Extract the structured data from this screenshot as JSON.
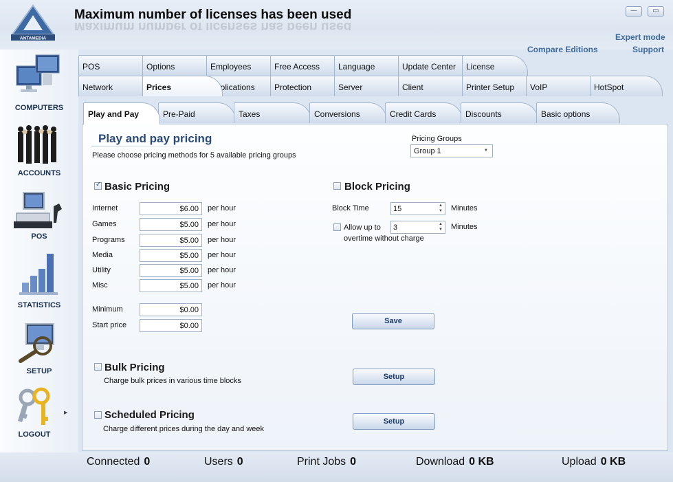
{
  "header": {
    "title": "Maximum number of licenses has been used",
    "logo_text": "ANTAMEDIA",
    "minimize_label": "—",
    "maximize_label": "▭",
    "expert_mode": "Expert mode",
    "compare_editions": "Compare Editions",
    "support": "Support"
  },
  "sidebar": {
    "items": [
      {
        "label": "COMPUTERS",
        "icon": "computers-icon"
      },
      {
        "label": "ACCOUNTS",
        "icon": "accounts-icon"
      },
      {
        "label": "POS",
        "icon": "pos-icon"
      },
      {
        "label": "STATISTICS",
        "icon": "statistics-icon"
      },
      {
        "label": "SETUP",
        "icon": "setup-icon"
      },
      {
        "label": "LOGOUT",
        "icon": "logout-icon"
      }
    ],
    "arrow": "▶"
  },
  "tabs_row1": [
    "POS",
    "Options",
    "Employees",
    "Free Access",
    "Language",
    "Update Center",
    "License"
  ],
  "tabs_row2": [
    "Network",
    "Prices",
    "Applications",
    "Protection",
    "Server",
    "Client",
    "Printer Setup",
    "VoIP",
    "HotSpot"
  ],
  "active_tab": "Prices",
  "subtabs": [
    "Play and Pay",
    "Pre-Paid",
    "Taxes",
    "Conversions",
    "Credit Cards",
    "Discounts",
    "Basic options"
  ],
  "active_subtab": "Play and Pay",
  "content": {
    "title": "Play and pay pricing",
    "subtitle": "Please choose pricing methods for 5 available pricing groups",
    "pricing_groups_label": "Pricing Groups",
    "pricing_group_value": "Group 1",
    "basic_pricing": {
      "label": "Basic Pricing",
      "checked": true,
      "rows": [
        {
          "label": "Internet",
          "value": "$6.00",
          "unit": "per hour"
        },
        {
          "label": "Games",
          "value": "$5.00",
          "unit": "per hour"
        },
        {
          "label": "Programs",
          "value": "$5.00",
          "unit": "per hour"
        },
        {
          "label": "Media",
          "value": "$5.00",
          "unit": "per hour"
        },
        {
          "label": "Utility",
          "value": "$5.00",
          "unit": "per hour"
        },
        {
          "label": "Misc",
          "value": "$5.00",
          "unit": "per hour"
        }
      ],
      "minimum_label": "Minimum",
      "minimum_value": "$0.00",
      "start_price_label": "Start price",
      "start_price_value": "$0.00"
    },
    "block_pricing": {
      "label": "Block Pricing",
      "checked": false,
      "block_time_label": "Block Time",
      "block_time_value": "15",
      "minutes_label": "Minutes",
      "allow_label": "Allow up to",
      "allow_value": "3",
      "allow_checked": false,
      "overtime_label": "overtime without charge"
    },
    "save_button": "Save",
    "bulk_pricing": {
      "label": "Bulk Pricing",
      "checked": false,
      "description": "Charge bulk prices in various time blocks",
      "button": "Setup"
    },
    "scheduled_pricing": {
      "label": "Scheduled Pricing",
      "checked": false,
      "description": "Charge different prices during the day and week",
      "button": "Setup"
    }
  },
  "status": {
    "connected_label": "Connected",
    "connected_value": "0",
    "users_label": "Users",
    "users_value": "0",
    "print_jobs_label": "Print Jobs",
    "print_jobs_value": "0",
    "download_label": "Download",
    "download_value": "0 KB",
    "upload_label": "Upload",
    "upload_value": "0 KB"
  },
  "colors": {
    "accent": "#3d6a9c",
    "title_blue": "#2a4a7a",
    "tab_fill": "#cfdbeb",
    "panel_bg": "#fdfeff"
  }
}
